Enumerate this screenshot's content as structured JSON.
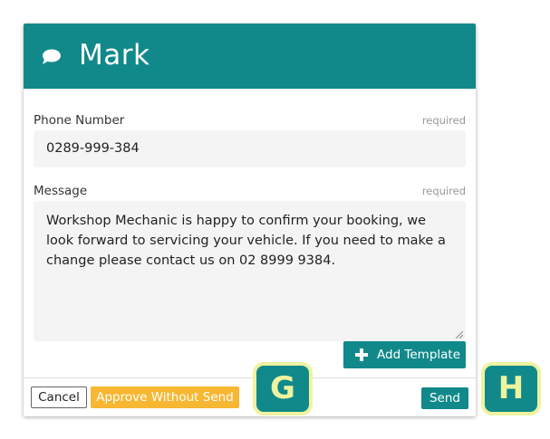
{
  "header": {
    "title": "Mark",
    "icon": "chat-bubble-icon",
    "color": "#11898a"
  },
  "phone": {
    "label": "Phone Number",
    "required": "required",
    "value": "0289-999-384"
  },
  "message": {
    "label": "Message",
    "required": "required",
    "value": "Workshop Mechanic is happy to confirm your booking, we look forward to servicing your vehicle. If you need to make a change please contact us on 02 8999 9384."
  },
  "template": {
    "add_label": "Add Template",
    "icon": "plus-icon"
  },
  "footer": {
    "cancel_label": "Cancel",
    "approve_label": "Approve Without Send",
    "approve_color": "#f7b733",
    "send_label": "Send"
  },
  "markers": {
    "g": "G",
    "h": "H",
    "border_color": "#eef3a0"
  }
}
